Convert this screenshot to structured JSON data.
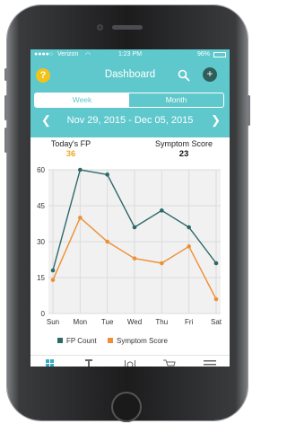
{
  "status": {
    "carrier": "Verizon",
    "time": "1:23 PM",
    "battery": "96%"
  },
  "nav": {
    "title": "Dashboard",
    "help_icon": "?",
    "add_icon": "+"
  },
  "segments": {
    "week": "Week",
    "month": "Month",
    "selected": "Week"
  },
  "date_range": "Nov 29, 2015 - Dec 05, 2015",
  "stats": {
    "fp_label": "Today's FP",
    "fp_value": "36",
    "symptom_label": "Symptom Score",
    "symptom_value": "23"
  },
  "colors": {
    "header": "#5fc8cc",
    "fp_series": "#2c6968",
    "symptom_series": "#ee8f33",
    "help": "#f2c318",
    "fp_value": "#f0a92b"
  },
  "chart_data": {
    "type": "line",
    "categories": [
      "Sun",
      "Mon",
      "Tue",
      "Wed",
      "Thu",
      "Fri",
      "Sat"
    ],
    "series": [
      {
        "name": "FP Count",
        "values": [
          18,
          60,
          58,
          36,
          43,
          36,
          21
        ]
      },
      {
        "name": "Symptom Score",
        "values": [
          14,
          40,
          30,
          23,
          21,
          28,
          6
        ]
      }
    ],
    "yticks": [
      0,
      15,
      30,
      45,
      60
    ],
    "ylim": [
      0,
      60
    ],
    "grid": true,
    "legend_position": "bottom"
  },
  "tabbar": {
    "icons": [
      "dashboard-icon",
      "hierarchy-icon",
      "meal-icon",
      "cart-icon",
      "menu-icon"
    ]
  }
}
